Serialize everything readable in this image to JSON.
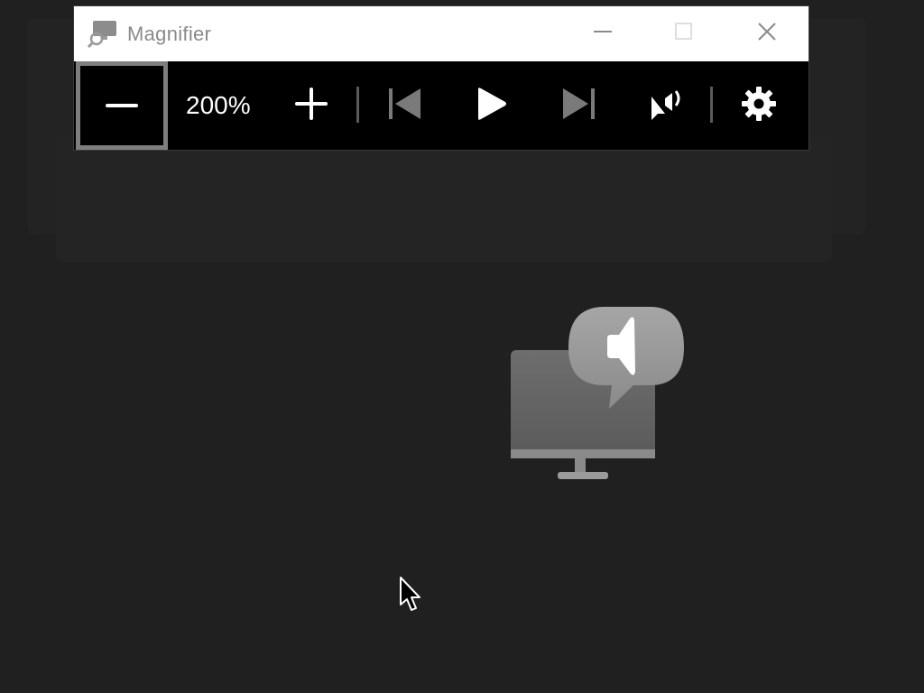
{
  "window": {
    "title": "Magnifier",
    "app_icon": "magnifier-app-icon",
    "caption_buttons": {
      "minimize_icon": "minimize-icon",
      "maximize_icon": "maximize-icon",
      "close_icon": "close-icon"
    }
  },
  "toolbar": {
    "zoom_out_icon": "minus-icon",
    "zoom_level": "200%",
    "zoom_in_icon": "plus-icon",
    "previous_icon": "skip-previous-icon",
    "play_icon": "play-icon",
    "next_icon": "skip-next-icon",
    "read_from_pointer_icon": "read-from-pointer-icon",
    "settings_icon": "gear-icon"
  },
  "desktop": {
    "illustration": "narrator-monitor-speaker-icon",
    "cursor": "mouse-pointer-icon"
  },
  "colors": {
    "desktop_background": "#202020",
    "titlebar_background": "#ffffff",
    "toolbar_background": "#000000",
    "focus_border": "#7e7e7e",
    "title_text": "#8a8a8a"
  }
}
